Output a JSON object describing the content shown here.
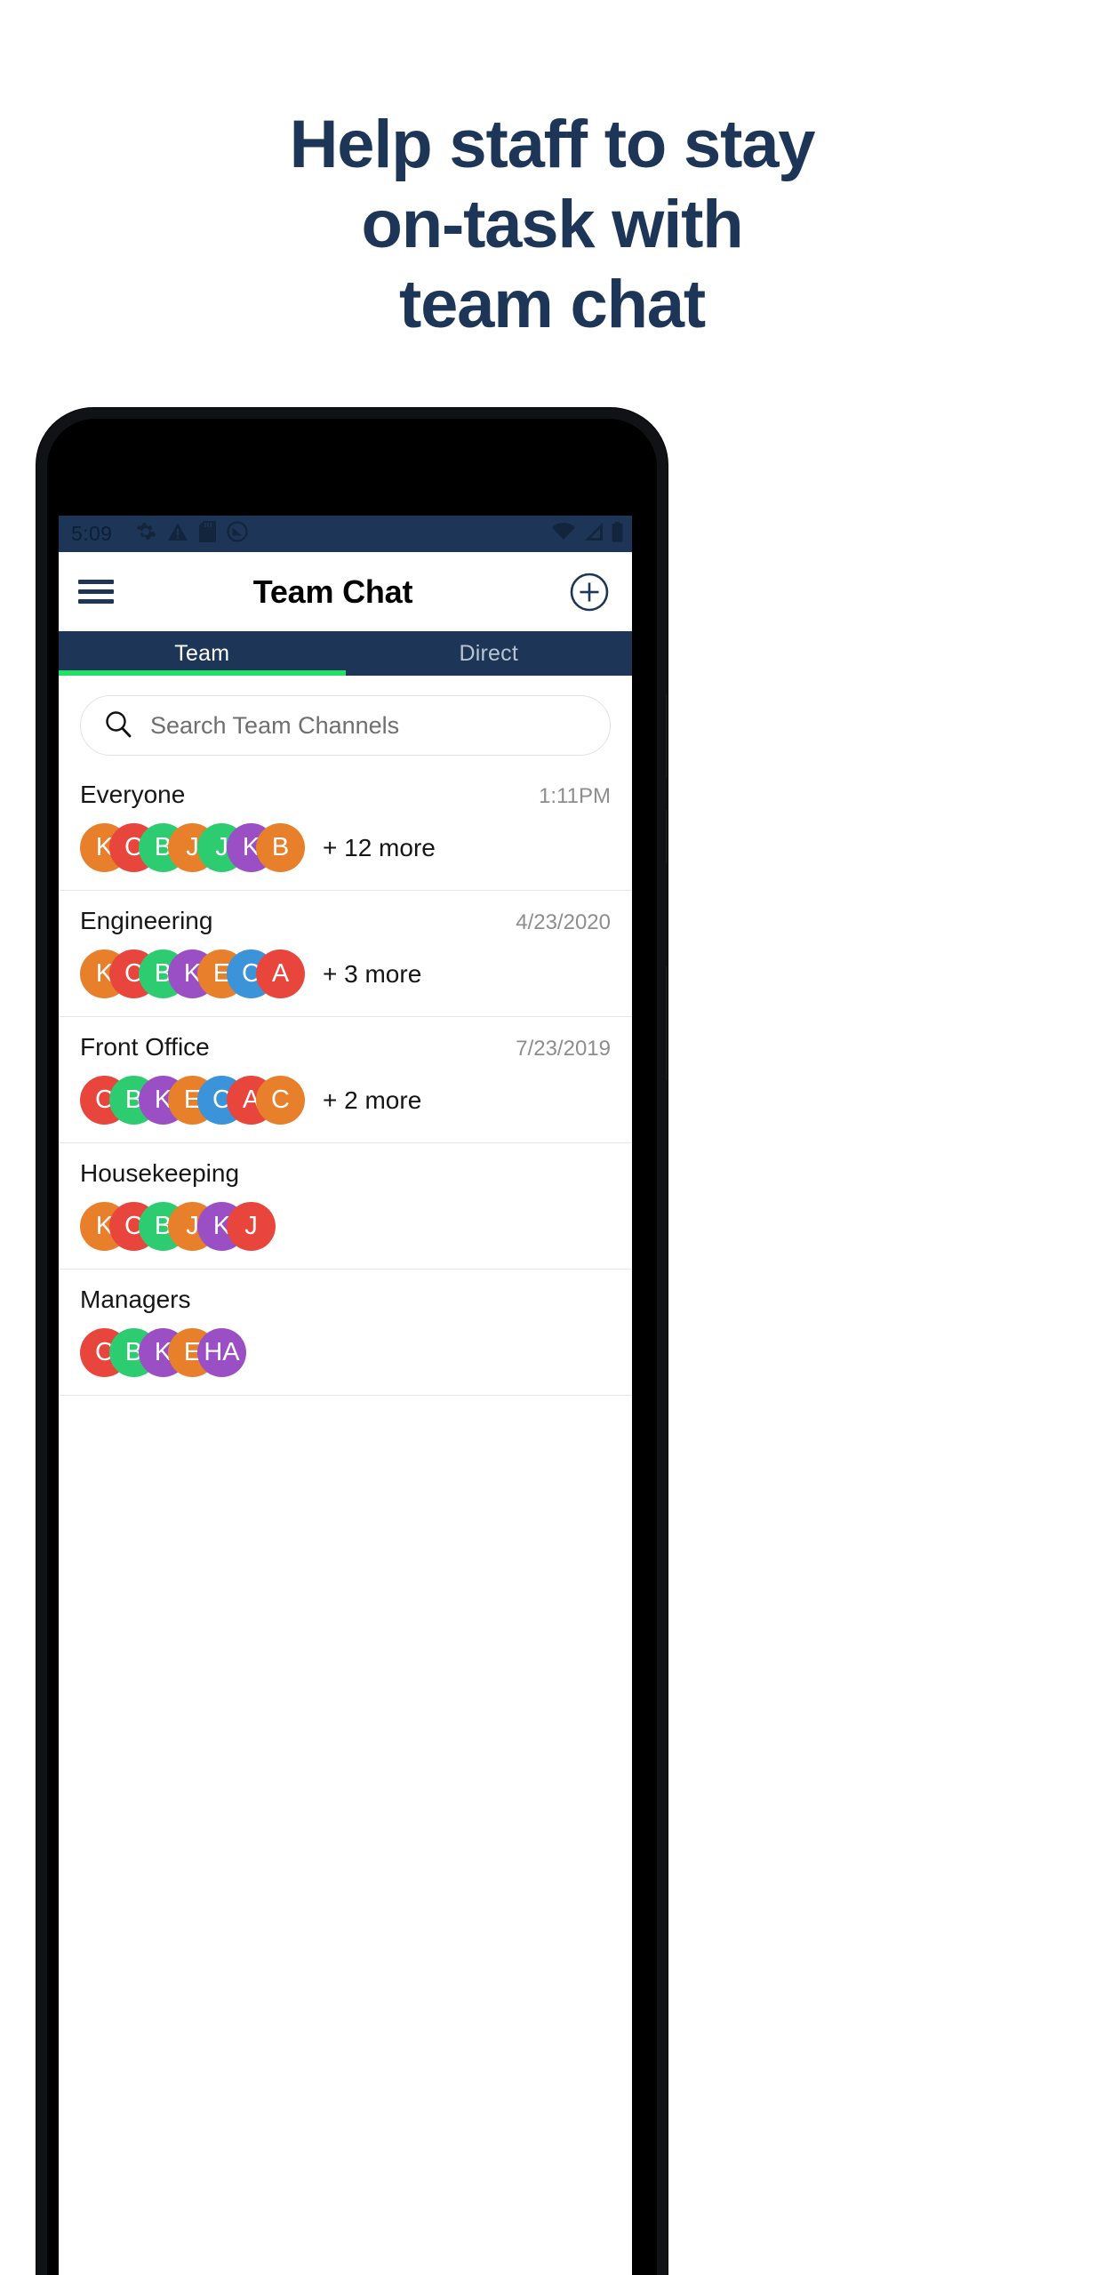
{
  "headline": {
    "lines": [
      "Help staff to stay",
      "on-task with",
      "team chat"
    ],
    "color": "#1d3557"
  },
  "phone": {
    "status_bar": {
      "time": "5:09",
      "left_icons": [
        "gear-icon",
        "warning-triangle-icon",
        "sd-card-icon",
        "do-not-disturb-icon"
      ],
      "right_icons": [
        "wifi-icon",
        "cellular-signal-icon",
        "battery-icon"
      ],
      "background_color": "#1d3557"
    },
    "app_bar": {
      "menu_icon": "hamburger-menu-icon",
      "title": "Team Chat",
      "action_icon": "plus-circle-icon"
    },
    "tabs": {
      "items": [
        {
          "label": "Team",
          "active": true
        },
        {
          "label": "Direct",
          "active": false
        }
      ],
      "active_indicator_color": "#21e065",
      "background_color": "#1d3557"
    },
    "search": {
      "icon": "search-icon",
      "placeholder": "Search Team Channels",
      "value": ""
    },
    "channels": [
      {
        "name": "Everyone",
        "time": "1:11PM",
        "more": "+ 12 more",
        "members": [
          {
            "initial": "K",
            "color": "#e8802b"
          },
          {
            "initial": "C",
            "color": "#e8453c"
          },
          {
            "initial": "B",
            "color": "#2ecc71"
          },
          {
            "initial": "J",
            "color": "#e8802b"
          },
          {
            "initial": "J",
            "color": "#2ecc71"
          },
          {
            "initial": "K",
            "color": "#9b4fc4"
          },
          {
            "initial": "B",
            "color": "#e8802b"
          }
        ]
      },
      {
        "name": "Engineering",
        "time": "4/23/2020",
        "more": "+ 3 more",
        "members": [
          {
            "initial": "K",
            "color": "#e8802b"
          },
          {
            "initial": "C",
            "color": "#e8453c"
          },
          {
            "initial": "B",
            "color": "#2ecc71"
          },
          {
            "initial": "K",
            "color": "#9b4fc4"
          },
          {
            "initial": "E",
            "color": "#e8802b"
          },
          {
            "initial": "C",
            "color": "#3b93d9"
          },
          {
            "initial": "A",
            "color": "#e8453c"
          }
        ]
      },
      {
        "name": "Front Office",
        "time": "7/23/2019",
        "more": "+ 2 more",
        "members": [
          {
            "initial": "C",
            "color": "#e8453c"
          },
          {
            "initial": "B",
            "color": "#2ecc71"
          },
          {
            "initial": "K",
            "color": "#9b4fc4"
          },
          {
            "initial": "E",
            "color": "#e8802b"
          },
          {
            "initial": "C",
            "color": "#3b93d9"
          },
          {
            "initial": "A",
            "color": "#e8453c"
          },
          {
            "initial": "C",
            "color": "#e8802b"
          }
        ]
      },
      {
        "name": "Housekeeping",
        "time": "",
        "more": "",
        "members": [
          {
            "initial": "K",
            "color": "#e8802b"
          },
          {
            "initial": "C",
            "color": "#e8453c"
          },
          {
            "initial": "B",
            "color": "#2ecc71"
          },
          {
            "initial": "J",
            "color": "#e8802b"
          },
          {
            "initial": "K",
            "color": "#9b4fc4"
          },
          {
            "initial": "J",
            "color": "#e8453c"
          }
        ]
      },
      {
        "name": "Managers",
        "time": "",
        "more": "",
        "members": [
          {
            "initial": "C",
            "color": "#e8453c"
          },
          {
            "initial": "B",
            "color": "#2ecc71"
          },
          {
            "initial": "K",
            "color": "#9b4fc4"
          },
          {
            "initial": "E",
            "color": "#e8802b"
          },
          {
            "initial": "HA",
            "color": "#9b4fc4"
          }
        ]
      }
    ]
  }
}
